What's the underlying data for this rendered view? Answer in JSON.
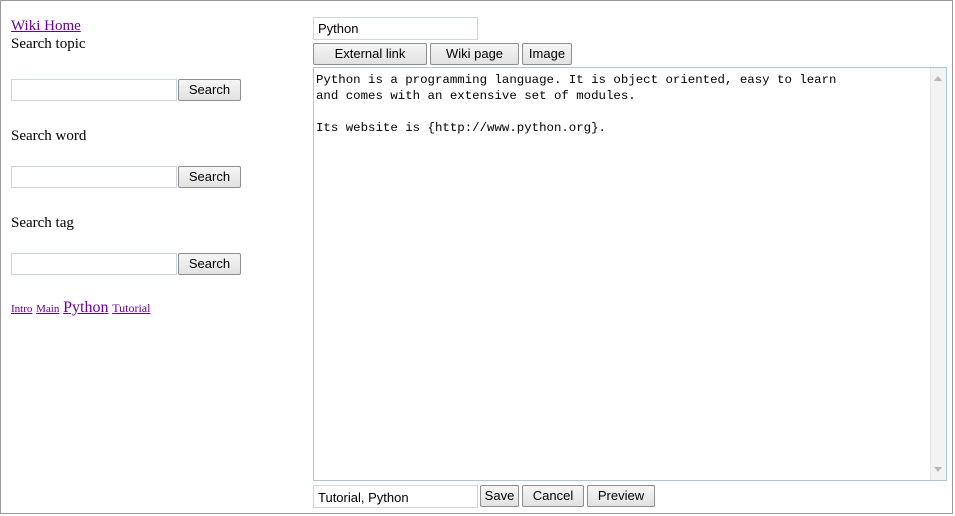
{
  "sidebar": {
    "home_link": "Wiki Home",
    "search_topic": {
      "label": "Search topic",
      "value": "",
      "button": "Search"
    },
    "search_word": {
      "label": "Search word",
      "value": "",
      "button": "Search"
    },
    "search_tag": {
      "label": "Search tag",
      "value": "",
      "button": "Search"
    },
    "tag_cloud": [
      "Intro",
      "Main",
      "Python",
      "Tutorial"
    ]
  },
  "editor": {
    "title_value": "Python",
    "toolbar": {
      "external_link": "External link",
      "wiki_page": "Wiki page",
      "image": "Image"
    },
    "content": "Python is a programming language. It is object oriented, easy to learn\nand comes with an extensive set of modules.\n\nIts website is {http://www.python.org}.",
    "tags_value": "Tutorial, Python",
    "save": "Save",
    "cancel": "Cancel",
    "preview": "Preview"
  }
}
